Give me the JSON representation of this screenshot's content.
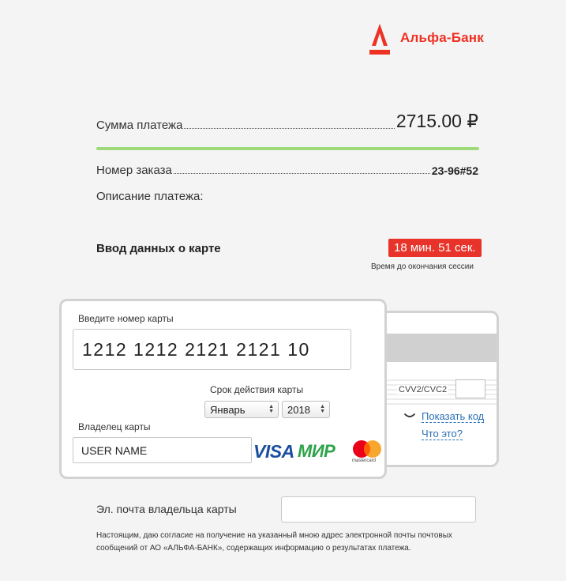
{
  "brand": {
    "name": "Альфа-Банк",
    "accent_color": "#ef3124",
    "logo_icon": "alfa-letter-a-icon"
  },
  "payment": {
    "amount_label": "Сумма платежа",
    "amount_value": "2715.00 ₽",
    "order_label": "Номер заказа",
    "order_value": "23-96#52",
    "description_label": "Описание платежа:"
  },
  "card_section": {
    "title": "Ввод данных о карте",
    "timer": "18 мин. 51 сек.",
    "timer_color": "#e8332a",
    "timer_caption": "Время до окончания сессии"
  },
  "card_front": {
    "number_label": "Введите номер карты",
    "number_value": "1212 1212 2121 2121 10",
    "expiry_label": "Срок действия карты",
    "expiry_month": "Январь",
    "expiry_year": "2018",
    "holder_label": "Владелец карты",
    "holder_value": "USER NAME"
  },
  "card_back": {
    "cvv_label": "CVV2/CVC2",
    "cvv_value": "",
    "show_code": "Показать код",
    "what_is": "Что это?"
  },
  "logos": {
    "visa": "VISA",
    "mir": "МИР",
    "mastercard": "mastercard"
  },
  "email": {
    "label": "Эл. почта владельца карты",
    "value": ""
  },
  "consent_text": "Настоящим, даю согласие на получение на указанный мною адрес электронной почты почтовых сообщений от АО «АЛЬФА-БАНК», содержащих информацию о результатах платежа."
}
